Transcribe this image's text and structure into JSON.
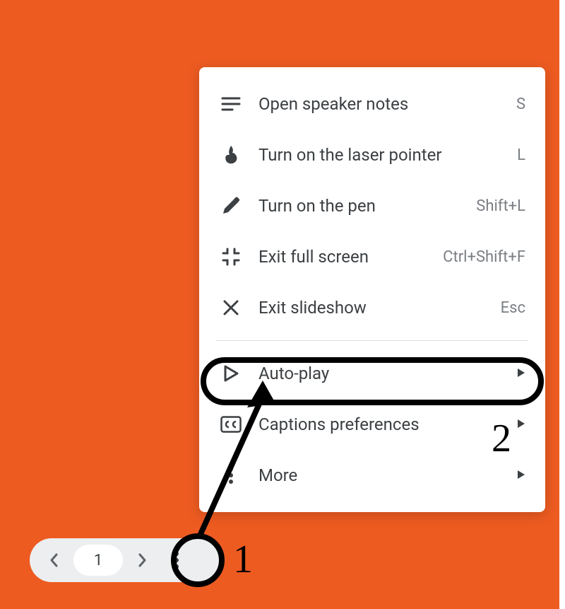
{
  "menu": {
    "items": [
      {
        "id": "open-speaker-notes",
        "label": "Open speaker notes",
        "shortcut": "S",
        "icon": "notes-icon",
        "submenu": false
      },
      {
        "id": "laser-pointer",
        "label": "Turn on the laser pointer",
        "shortcut": "L",
        "icon": "laser-icon",
        "submenu": false
      },
      {
        "id": "pen",
        "label": "Turn on the pen",
        "shortcut": "Shift+L",
        "icon": "pen-icon",
        "submenu": false
      },
      {
        "id": "exit-full-screen",
        "label": "Exit full screen",
        "shortcut": "Ctrl+Shift+F",
        "icon": "exit-full-icon",
        "submenu": false
      },
      {
        "id": "exit-slideshow",
        "label": "Exit slideshow",
        "shortcut": "Esc",
        "icon": "close-icon",
        "submenu": false
      }
    ],
    "sub_items": [
      {
        "id": "auto-play",
        "label": "Auto-play",
        "icon": "play-outline-icon",
        "submenu": true
      },
      {
        "id": "captions-preferences",
        "label": "Captions preferences",
        "icon": "cc-icon",
        "submenu": true
      },
      {
        "id": "more",
        "label": "More",
        "icon": "more-vert-icon",
        "submenu": true
      }
    ]
  },
  "toolbar": {
    "slide_number": "1"
  },
  "annotations": {
    "step1": "1",
    "step2": "2"
  },
  "colors": {
    "background": "#ed5b21",
    "menu_text": "#3c4043",
    "shortcut_text": "#7b7f84"
  }
}
